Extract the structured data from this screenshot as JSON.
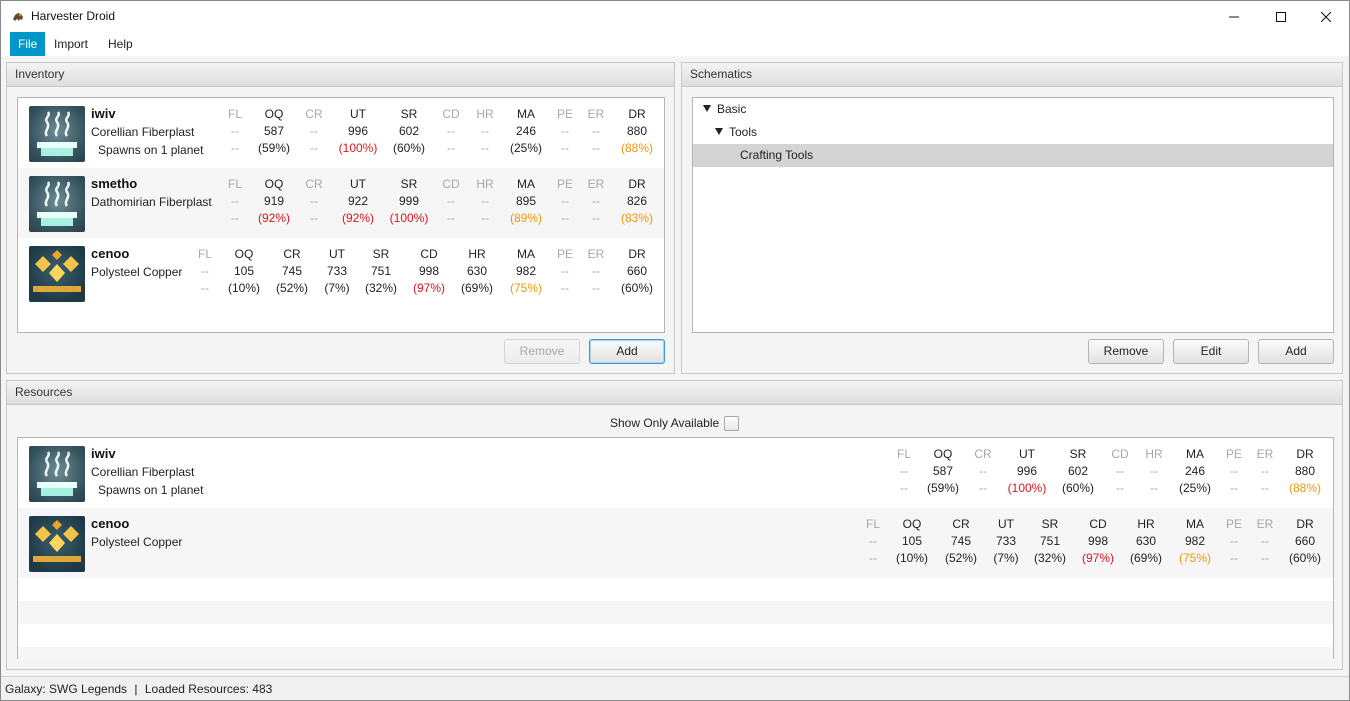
{
  "window": {
    "title": "Harvester Droid",
    "minimize_icon": "minimize-icon",
    "maximize_icon": "maximize-icon",
    "close_icon": "close-icon"
  },
  "menu": [
    {
      "label": "File",
      "active": true
    },
    {
      "label": "Import"
    },
    {
      "label": "Help"
    }
  ],
  "inventory": {
    "title": "Inventory",
    "remove_label": "Remove",
    "add_label": "Add",
    "items": [
      {
        "name": "iwiv",
        "type": "Corellian Fiberplast",
        "spawn": "Spawns on 1 planet",
        "icon": "fiberplast-icon",
        "stats": [
          {
            "h": "FL",
            "v": "--",
            "p": "--",
            "na": true
          },
          {
            "h": "OQ",
            "v": "587",
            "p": "(59%)"
          },
          {
            "h": "CR",
            "v": "--",
            "p": "--",
            "na": true
          },
          {
            "h": "UT",
            "v": "996",
            "p": "(100%)",
            "c": "red"
          },
          {
            "h": "SR",
            "v": "602",
            "p": "(60%)"
          },
          {
            "h": "CD",
            "v": "--",
            "p": "--",
            "na": true
          },
          {
            "h": "HR",
            "v": "--",
            "p": "--",
            "na": true
          },
          {
            "h": "MA",
            "v": "246",
            "p": "(25%)"
          },
          {
            "h": "PE",
            "v": "--",
            "p": "--",
            "na": true
          },
          {
            "h": "ER",
            "v": "--",
            "p": "--",
            "na": true
          },
          {
            "h": "DR",
            "v": "880",
            "p": "(88%)",
            "c": "orange"
          }
        ]
      },
      {
        "name": "smetho",
        "type": "Dathomirian Fiberplast",
        "spawn": "",
        "icon": "fiberplast-icon",
        "stats": [
          {
            "h": "FL",
            "v": "--",
            "p": "--",
            "na": true
          },
          {
            "h": "OQ",
            "v": "919",
            "p": "(92%)",
            "c": "red"
          },
          {
            "h": "CR",
            "v": "--",
            "p": "--",
            "na": true
          },
          {
            "h": "UT",
            "v": "922",
            "p": "(92%)",
            "c": "red"
          },
          {
            "h": "SR",
            "v": "999",
            "p": "(100%)",
            "c": "red"
          },
          {
            "h": "CD",
            "v": "--",
            "p": "--",
            "na": true
          },
          {
            "h": "HR",
            "v": "--",
            "p": "--",
            "na": true
          },
          {
            "h": "MA",
            "v": "895",
            "p": "(89%)",
            "c": "orange"
          },
          {
            "h": "PE",
            "v": "--",
            "p": "--",
            "na": true
          },
          {
            "h": "ER",
            "v": "--",
            "p": "--",
            "na": true
          },
          {
            "h": "DR",
            "v": "826",
            "p": "(83%)",
            "c": "orange"
          }
        ]
      },
      {
        "name": "cenoo",
        "type": "Polysteel Copper",
        "spawn": "",
        "icon": "copper-icon",
        "stats": [
          {
            "h": "FL",
            "v": "--",
            "p": "--",
            "na": true
          },
          {
            "h": "OQ",
            "v": "105",
            "p": "(10%)"
          },
          {
            "h": "CR",
            "v": "745",
            "p": "(52%)"
          },
          {
            "h": "UT",
            "v": "733",
            "p": "(7%)"
          },
          {
            "h": "SR",
            "v": "751",
            "p": "(32%)"
          },
          {
            "h": "CD",
            "v": "998",
            "p": "(97%)",
            "c": "red"
          },
          {
            "h": "HR",
            "v": "630",
            "p": "(69%)"
          },
          {
            "h": "MA",
            "v": "982",
            "p": "(75%)",
            "c": "orange"
          },
          {
            "h": "PE",
            "v": "--",
            "p": "--",
            "na": true
          },
          {
            "h": "ER",
            "v": "--",
            "p": "--",
            "na": true
          },
          {
            "h": "DR",
            "v": "660",
            "p": "(60%)"
          }
        ]
      }
    ]
  },
  "schematics": {
    "title": "Schematics",
    "tree": [
      {
        "label": "Basic",
        "expanded": true,
        "depth": 0
      },
      {
        "label": "Tools",
        "expanded": true,
        "depth": 1
      },
      {
        "label": "Crafting Tools",
        "depth": 2,
        "selected": true
      }
    ],
    "remove_label": "Remove",
    "edit_label": "Edit",
    "add_label": "Add"
  },
  "resources": {
    "title": "Resources",
    "show_only_available_label": "Show Only Available",
    "show_only_available_checked": false,
    "items": [
      {
        "name": "iwiv",
        "type": "Corellian Fiberplast",
        "spawn": "Spawns on 1 planet",
        "icon": "fiberplast-icon",
        "stats": [
          {
            "h": "FL",
            "v": "--",
            "p": "--",
            "na": true
          },
          {
            "h": "OQ",
            "v": "587",
            "p": "(59%)"
          },
          {
            "h": "CR",
            "v": "--",
            "p": "--",
            "na": true
          },
          {
            "h": "UT",
            "v": "996",
            "p": "(100%)",
            "c": "red"
          },
          {
            "h": "SR",
            "v": "602",
            "p": "(60%)"
          },
          {
            "h": "CD",
            "v": "--",
            "p": "--",
            "na": true
          },
          {
            "h": "HR",
            "v": "--",
            "p": "--",
            "na": true
          },
          {
            "h": "MA",
            "v": "246",
            "p": "(25%)"
          },
          {
            "h": "PE",
            "v": "--",
            "p": "--",
            "na": true
          },
          {
            "h": "ER",
            "v": "--",
            "p": "--",
            "na": true
          },
          {
            "h": "DR",
            "v": "880",
            "p": "(88%)",
            "c": "orange"
          }
        ]
      },
      {
        "name": "cenoo",
        "type": "Polysteel Copper",
        "spawn": "",
        "icon": "copper-icon",
        "stats": [
          {
            "h": "FL",
            "v": "--",
            "p": "--",
            "na": true
          },
          {
            "h": "OQ",
            "v": "105",
            "p": "(10%)"
          },
          {
            "h": "CR",
            "v": "745",
            "p": "(52%)"
          },
          {
            "h": "UT",
            "v": "733",
            "p": "(7%)"
          },
          {
            "h": "SR",
            "v": "751",
            "p": "(32%)"
          },
          {
            "h": "CD",
            "v": "998",
            "p": "(97%)",
            "c": "red"
          },
          {
            "h": "HR",
            "v": "630",
            "p": "(69%)"
          },
          {
            "h": "MA",
            "v": "982",
            "p": "(75%)",
            "c": "orange"
          },
          {
            "h": "PE",
            "v": "--",
            "p": "--",
            "na": true
          },
          {
            "h": "ER",
            "v": "--",
            "p": "--",
            "na": true
          },
          {
            "h": "DR",
            "v": "660",
            "p": "(60%)"
          }
        ]
      }
    ]
  },
  "status": {
    "galaxy": "Galaxy: SWG Legends",
    "separator": "|",
    "loaded": "Loaded Resources: 483"
  },
  "colors": {
    "accent": "#0096c9",
    "high": "#e0141e",
    "mid": "#f0960a"
  }
}
